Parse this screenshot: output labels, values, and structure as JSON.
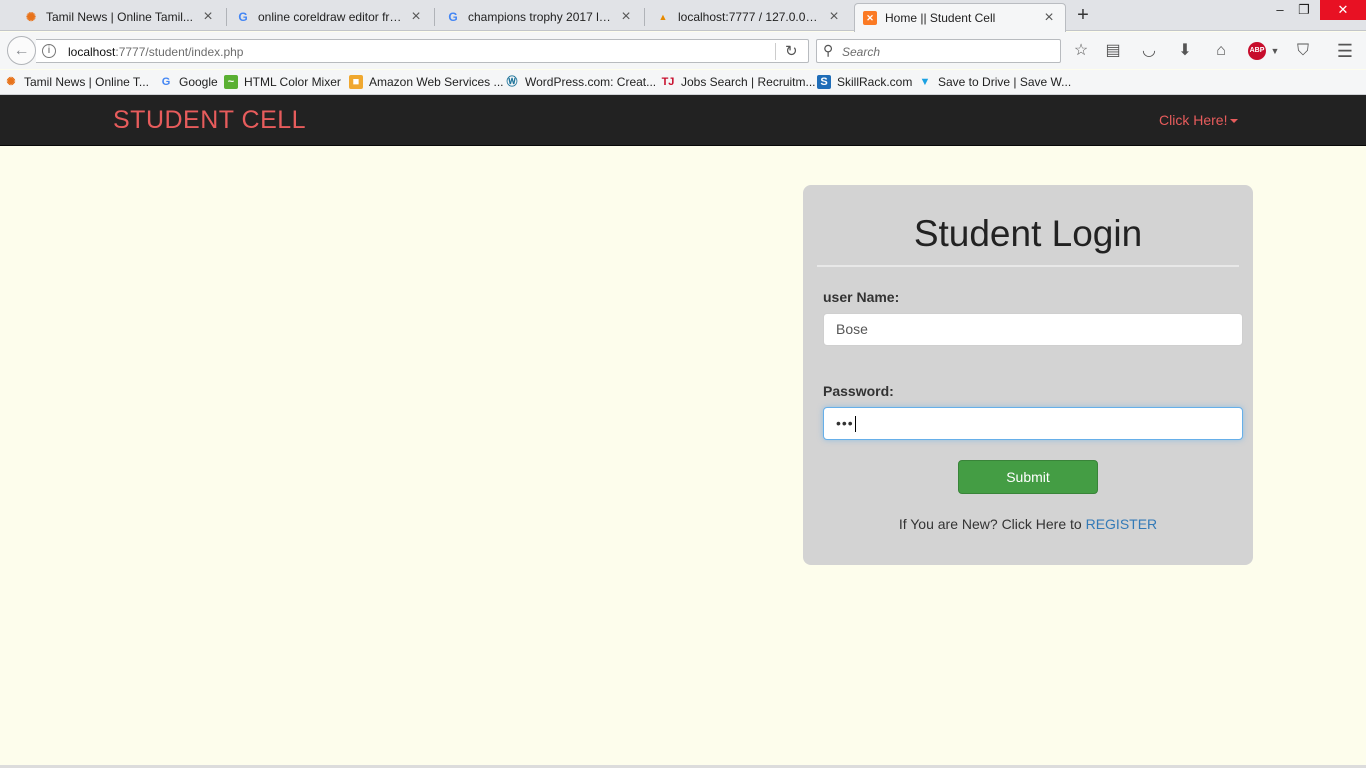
{
  "browser": {
    "tabs": [
      {
        "title": "Tamil News | Online Tamil...",
        "icon": "tamil-news-icon"
      },
      {
        "title": "online coreldraw editor fre...",
        "icon": "google-icon"
      },
      {
        "title": "champions trophy 2017 liv...",
        "icon": "google-icon"
      },
      {
        "title": "localhost:7777 / 127.0.0.1 |...",
        "icon": "phpmyadmin-icon"
      },
      {
        "title": "Home || Student Cell",
        "icon": "xampp-icon"
      }
    ],
    "url_host": "localhost",
    "url_rest": ":7777/student/index.php",
    "search_placeholder": "Search",
    "bookmarks": [
      {
        "label": "Tamil News | Online T...",
        "icon": "tamil-news-icon"
      },
      {
        "label": "Google",
        "icon": "google-icon"
      },
      {
        "label": "HTML Color Mixer",
        "icon": "color-mixer-icon"
      },
      {
        "label": "Amazon Web Services ...",
        "icon": "aws-icon"
      },
      {
        "label": "WordPress.com: Creat...",
        "icon": "wordpress-icon"
      },
      {
        "label": "Jobs Search | Recruitm...",
        "icon": "timesjobs-icon"
      },
      {
        "label": "SkillRack.com",
        "icon": "skillrack-icon"
      },
      {
        "label": "Save to Drive | Save W...",
        "icon": "save-to-drive-icon"
      }
    ],
    "abp_label": "ABP"
  },
  "site": {
    "brand": "STUDENT CELL",
    "dropdown_label": "Click Here!",
    "brand_color": "#e75c5c"
  },
  "login": {
    "title": "Student Login",
    "username_label": "user Name:",
    "username_value": "Bose",
    "password_label": "Password:",
    "password_mask": "•••",
    "submit_label": "Submit",
    "register_prompt": "If You are New? Click Here to",
    "register_link": "REGISTER",
    "submit_color": "#449d44",
    "link_color": "#337ab7"
  }
}
